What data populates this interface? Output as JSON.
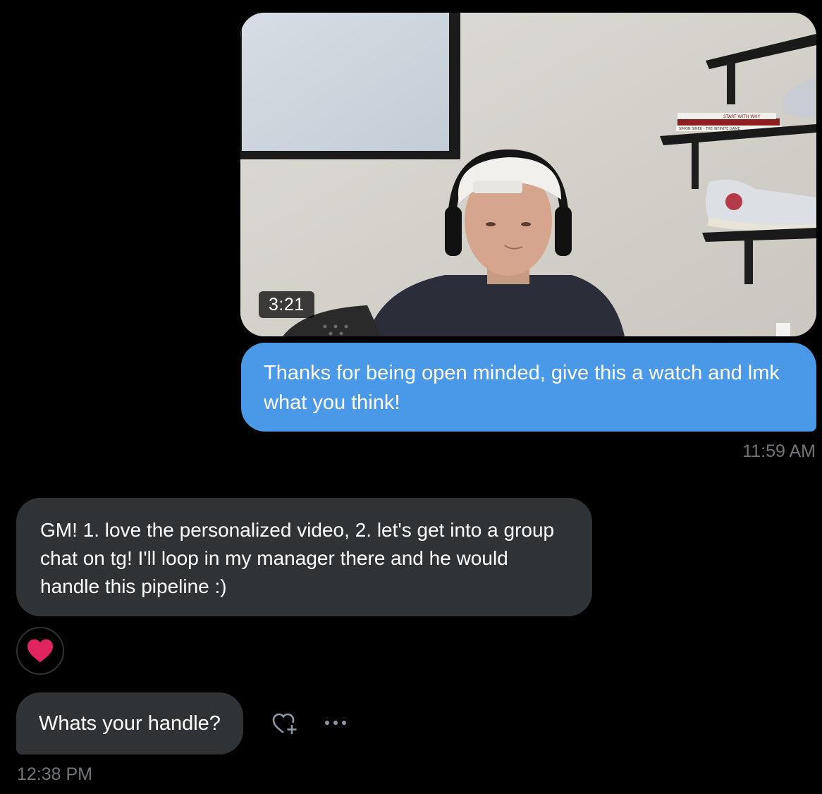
{
  "conversation": {
    "video_message": {
      "duration": "3:21",
      "scene_text": {
        "book_top": "START WITH WHY",
        "book_bottom": "SIMON SINEK · THE INFINITE GAME"
      }
    },
    "outgoing_message": {
      "text": "Thanks for being open minded, give this a watch and lmk what you think!",
      "time": "11:59 AM"
    },
    "incoming_message_1": {
      "text": "GM! 1. love the personalized video, 2. let's get into a group chat on tg! I'll loop in my manager there and he would handle this pipeline :)",
      "reaction": "heart-icon"
    },
    "incoming_message_2": {
      "text": "Whats your handle?",
      "time": "12:38 PM"
    },
    "message_actions": {
      "react_icon": "heart-plus-icon",
      "more_icon": "more-dots-icon"
    }
  },
  "colors": {
    "background": "#000000",
    "outgoing_bubble": "#4a99e9",
    "incoming_bubble": "#2f3336",
    "timestamp": "#71767b",
    "heart": "#e0245e"
  }
}
